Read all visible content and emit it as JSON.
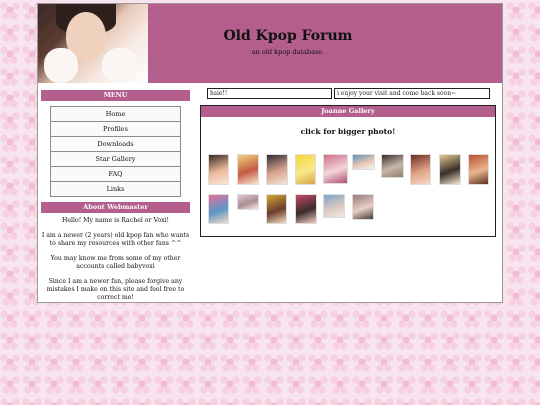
{
  "header": {
    "title": "Old Kpop Forum",
    "subtitle": "an old kpop database."
  },
  "menu": {
    "heading": "MENU",
    "items": [
      "Home",
      "Profiles",
      "Downloads",
      "Star Gallery",
      "FAQ",
      "Links"
    ]
  },
  "about": {
    "heading": "About Webmaster",
    "paragraphs": [
      "Hello! My name is Rachel or Voxi!",
      "I am a newer (2 years) old kpop fan who wants to share my resources with other fans ^^",
      "You may know me from some of my other accounts called babyvoxi",
      "Since I am a newer fan, please forgive any mistakes I make on this site and feel free to correct me!"
    ]
  },
  "fields": {
    "left_value": "hsie!!",
    "right_value": "i enjoy your visit and come back soon~"
  },
  "gallery": {
    "heading": "Joanne Gallery",
    "note": "click for bigger photo!",
    "thumbnails": [
      "joanne-photo-1",
      "joanne-photo-2",
      "joanne-photo-3",
      "joanne-photo-4",
      "joanne-photo-5",
      "joanne-photo-6",
      "joanne-photo-7",
      "joanne-photo-8",
      "joanne-photo-9",
      "joanne-photo-10",
      "joanne-photo-11",
      "joanne-photo-12",
      "joanne-photo-13",
      "joanne-photo-14",
      "joanne-photo-15",
      "joanne-photo-16"
    ]
  },
  "colors": {
    "accent": "#b45e8d",
    "background": "#f7e4ee"
  }
}
